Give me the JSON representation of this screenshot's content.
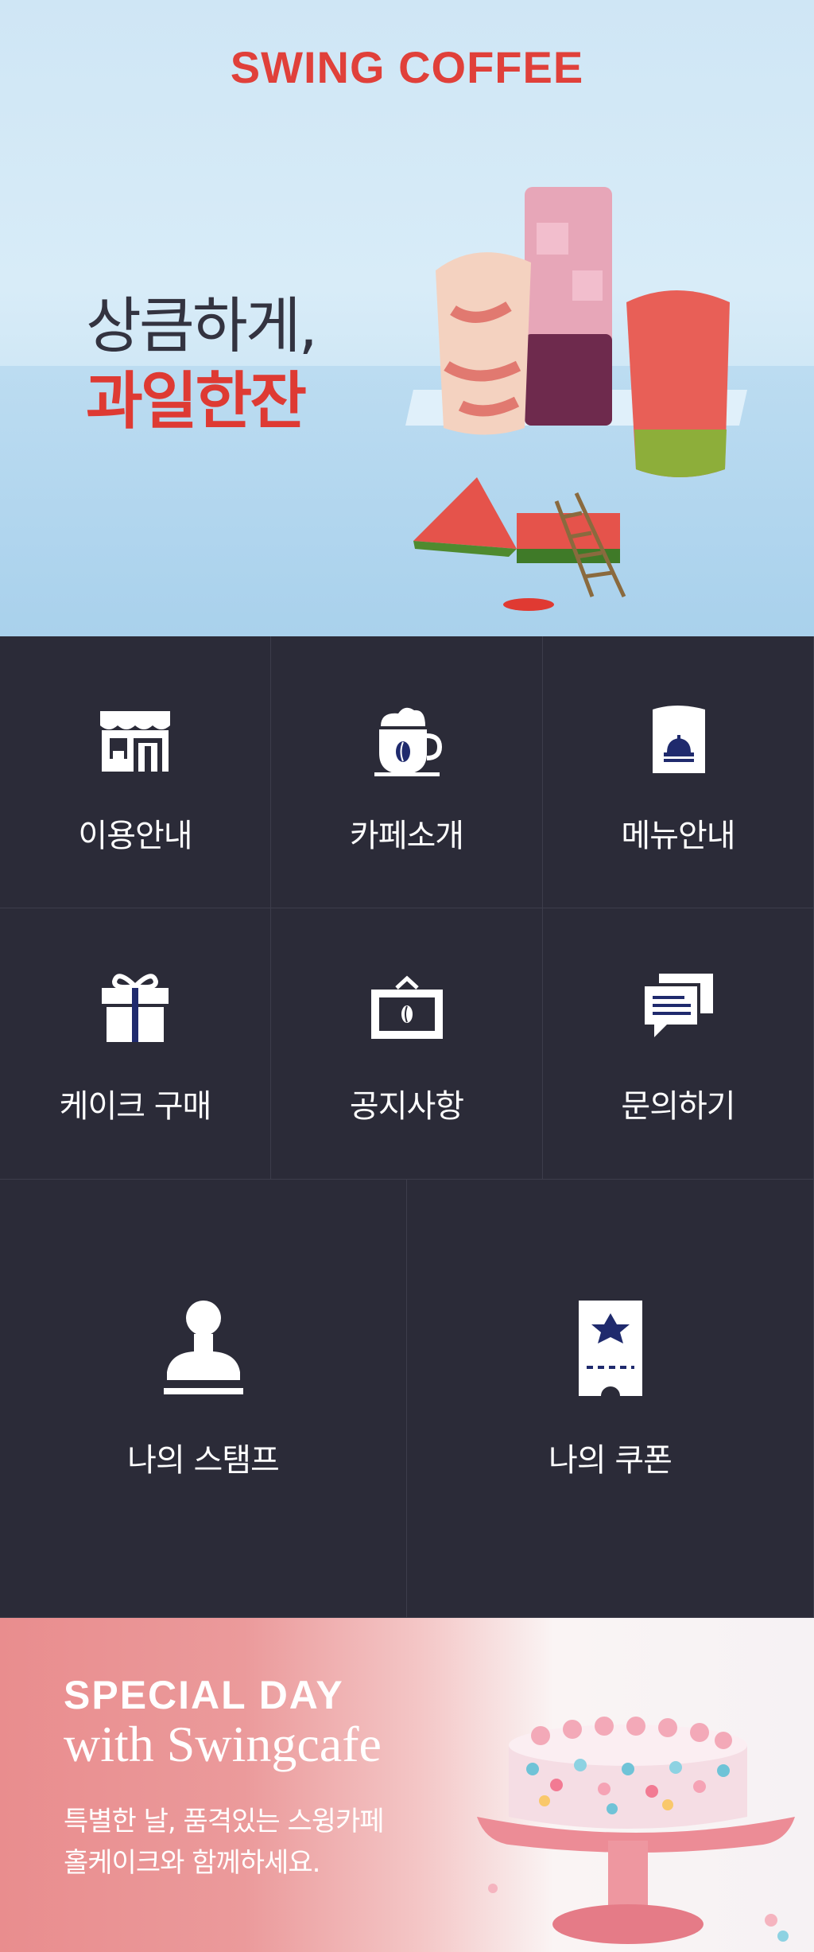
{
  "app": {
    "brand": "SWING COFFEE",
    "accent_color": "#e0403a"
  },
  "hero": {
    "line1": "상큼하게,",
    "line2": "과일한잔"
  },
  "menu": {
    "items": [
      {
        "label": "이용안내",
        "icon": "store-icon"
      },
      {
        "label": "카페소개",
        "icon": "coffee-cup-icon"
      },
      {
        "label": "메뉴안내",
        "icon": "menu-book-icon"
      },
      {
        "label": "케이크 구매",
        "icon": "gift-icon"
      },
      {
        "label": "공지사항",
        "icon": "notice-board-icon"
      },
      {
        "label": "문의하기",
        "icon": "chat-bubbles-icon"
      },
      {
        "label": "나의 스탬프",
        "icon": "stamp-icon"
      },
      {
        "label": "나의 쿠폰",
        "icon": "coupon-icon"
      }
    ]
  },
  "banner": {
    "title": "SPECIAL DAY",
    "subtitle": "with Swingcafe",
    "line1": "특별한 날, 품격있는 스윙카페",
    "line2": "홀케이크와 함께하세요."
  }
}
